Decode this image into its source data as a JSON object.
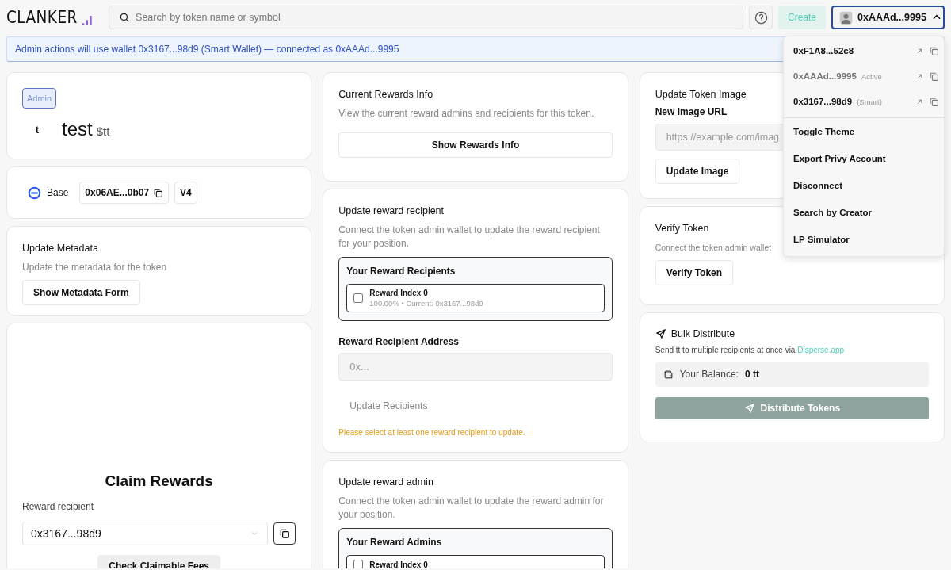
{
  "header": {
    "logo": "CLANKER",
    "search": {
      "placeholder": "Search by token name or symbol"
    },
    "create_button": "Create",
    "account": {
      "address": "0xAAAd...9995",
      "expanded": true
    }
  },
  "banner": "Admin actions will use wallet 0x3167...98d9 (Smart Wallet) — connected as 0xAAAd...9995",
  "columns": [
    [
      {
        "kind": "token",
        "badge": "Admin",
        "avatar": "t",
        "name": "test",
        "symbol": "$tt"
      },
      {
        "kind": "chain",
        "chain": "Base",
        "address": "0x06AE...0b07",
        "version": "V4"
      },
      {
        "kind": "action",
        "title": "Update Metadata",
        "description": "Update the metadata for the token",
        "button": "Show Metadata Form"
      },
      {
        "kind": "claim",
        "title": "Claim Rewards",
        "label": "Reward recipient",
        "select": "0x3167...98d9",
        "button": "Check Claimable Fees"
      }
    ],
    [
      {
        "kind": "info",
        "title": "Current Rewards Info",
        "description": "View the current reward admins and recipients for this token.",
        "button": "Show Rewards Info"
      },
      {
        "kind": "recipients",
        "title": "Update reward recipient",
        "description": "Connect the token admin wallet to update the reward recipient for your position.",
        "list_title": "Your Reward Recipients",
        "items": [
          {
            "label": "Reward Index 0",
            "detail": "100.00% • Current: 0x3167...98d9",
            "checked": false
          }
        ],
        "field_label": "Reward Recipient Address",
        "field": {
          "placeholder": "0x..."
        },
        "button": "Update Recipients",
        "button_disabled": true,
        "warning": "Please select at least one reward recipient to update."
      },
      {
        "kind": "recipients",
        "title": "Update reward admin",
        "description": "Connect the token admin wallet to update the reward admin for your position.",
        "list_title": "Your Reward Admins",
        "items": [
          {
            "label": "Reward Index 0",
            "checked": false
          }
        ]
      }
    ],
    [
      {
        "kind": "image",
        "title": "Update Token Image",
        "field_label": "New Image URL",
        "field": {
          "placeholder": "https://example.com/imag"
        },
        "button": "Update Image"
      },
      {
        "kind": "action",
        "title": "Verify Token",
        "description": "Connect the token admin wallet",
        "button": "Verify Token"
      },
      {
        "kind": "bulk",
        "title": "Bulk Distribute",
        "description": "Send tt to multiple recipients at once via",
        "link": "Disperse.app",
        "balance_label": "Your Balance:",
        "balance": "0 tt",
        "button": "Distribute Tokens",
        "button_disabled": true
      }
    ]
  ],
  "menu": {
    "wallets": [
      {
        "address": "0xF1A8...52c8",
        "active": false
      },
      {
        "address": "0xAAAd...9995",
        "tag": "Active",
        "active": true
      },
      {
        "address": "0x3167...98d9",
        "tag": "(Smart)",
        "active": false
      }
    ],
    "actions": [
      "Toggle Theme",
      "Export Privy Account",
      "Disconnect",
      "Search by Creator",
      "LP Simulator"
    ]
  }
}
